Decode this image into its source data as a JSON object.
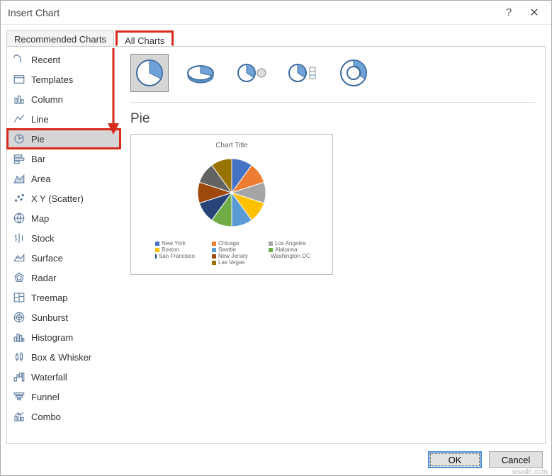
{
  "titlebar": {
    "title": "Insert Chart"
  },
  "tabs": {
    "recommended": "Recommended Charts",
    "all": "All Charts"
  },
  "sidebar": {
    "items": [
      {
        "label": "Recent"
      },
      {
        "label": "Templates"
      },
      {
        "label": "Column"
      },
      {
        "label": "Line"
      },
      {
        "label": "Pie"
      },
      {
        "label": "Bar"
      },
      {
        "label": "Area"
      },
      {
        "label": "X Y (Scatter)"
      },
      {
        "label": "Map"
      },
      {
        "label": "Stock"
      },
      {
        "label": "Surface"
      },
      {
        "label": "Radar"
      },
      {
        "label": "Treemap"
      },
      {
        "label": "Sunburst"
      },
      {
        "label": "Histogram"
      },
      {
        "label": "Box & Whisker"
      },
      {
        "label": "Waterfall"
      },
      {
        "label": "Funnel"
      },
      {
        "label": "Combo"
      }
    ]
  },
  "main": {
    "chart_name": "Pie",
    "preview_title": "Chart Title"
  },
  "chart_data": {
    "type": "pie",
    "title": "Chart Title",
    "series": [
      {
        "name": "New York",
        "value": 10,
        "color": "#4472c4"
      },
      {
        "name": "Chicago",
        "value": 10,
        "color": "#ed7d31"
      },
      {
        "name": "Los Angeles",
        "value": 10,
        "color": "#a5a5a5"
      },
      {
        "name": "Boston",
        "value": 10,
        "color": "#ffc000"
      },
      {
        "name": "Seattle",
        "value": 10,
        "color": "#5b9bd5"
      },
      {
        "name": "Alabama",
        "value": 10,
        "color": "#70ad47"
      },
      {
        "name": "San Francisco",
        "value": 10,
        "color": "#264478"
      },
      {
        "name": "New Jersey",
        "value": 10,
        "color": "#9e480e"
      },
      {
        "name": "Washington DC",
        "value": 10,
        "color": "#636363"
      },
      {
        "name": "Las Vegas",
        "value": 10,
        "color": "#997300"
      }
    ]
  },
  "footer": {
    "ok": "OK",
    "cancel": "Cancel"
  },
  "watermark": "wsxdn.com"
}
